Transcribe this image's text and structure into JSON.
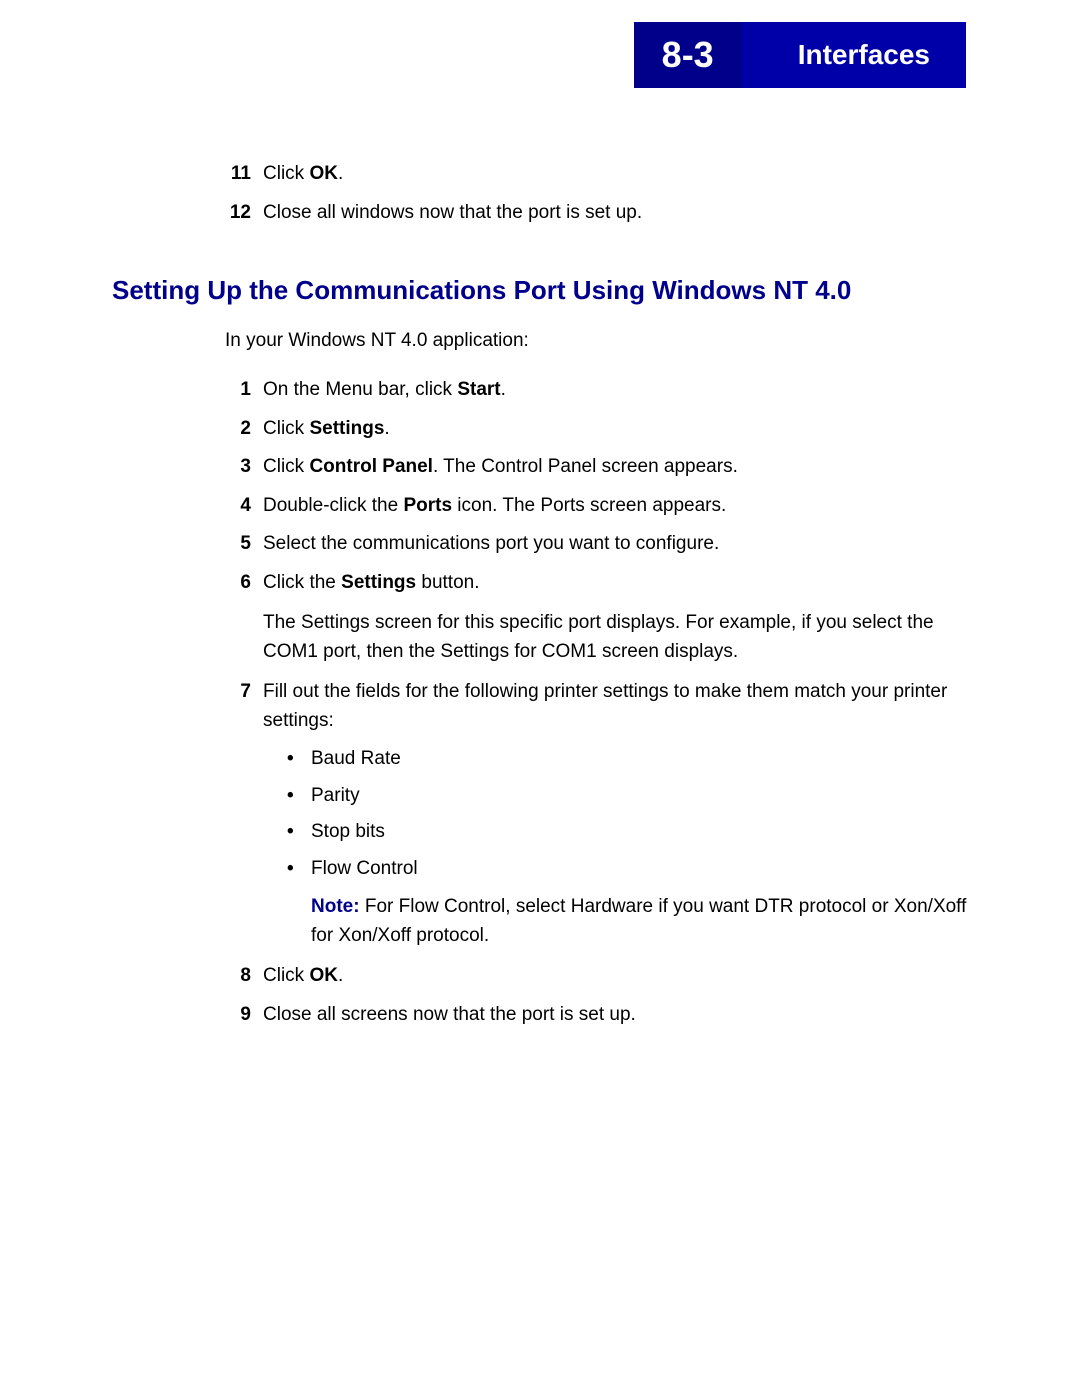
{
  "header": {
    "page_number": "8-3",
    "title": "Interfaces"
  },
  "top_steps": [
    {
      "num": "11",
      "text_prefix": "Click ",
      "bold": "OK",
      "text_suffix": "."
    },
    {
      "num": "12",
      "text": "Close all windows now that the port is set up."
    }
  ],
  "section_heading": "Setting Up the Communications Port Using Windows NT 4.0",
  "intro": "In your Windows NT 4.0 application:",
  "steps": {
    "s1": {
      "num": "1",
      "prefix": "On the Menu bar, click ",
      "bold": "Start",
      "suffix": "."
    },
    "s2": {
      "num": "2",
      "prefix": "Click ",
      "bold": "Settings",
      "suffix": "."
    },
    "s3": {
      "num": "3",
      "prefix": "Click ",
      "bold": "Control Panel",
      "suffix": ". The Control Panel screen appears."
    },
    "s4": {
      "num": "4",
      "prefix": "Double-click the ",
      "bold": "Ports",
      "suffix": " icon. The Ports screen appears."
    },
    "s5": {
      "num": "5",
      "text": "Select the communications port you want to configure."
    },
    "s6": {
      "num": "6",
      "prefix": "Click the ",
      "bold": "Settings",
      "suffix": " button."
    },
    "s6_para": "The Settings screen for this specific port displays. For example, if you select the COM1 port, then the Settings for COM1 screen displays.",
    "s7": {
      "num": "7",
      "text": "Fill out the fields for the following printer settings to make them match your printer settings:"
    },
    "s7_bullets": [
      "Baud Rate",
      "Parity",
      "Stop bits",
      "Flow Control"
    ],
    "s7_note_label": "Note:",
    "s7_note_text": "  For Flow Control, select Hardware if you want DTR protocol or Xon/Xoff for Xon/Xoff protocol.",
    "s8": {
      "num": "8",
      "prefix": "Click ",
      "bold": "OK",
      "suffix": "."
    },
    "s9": {
      "num": "9",
      "text": "Close all screens now that the port is set up."
    }
  }
}
